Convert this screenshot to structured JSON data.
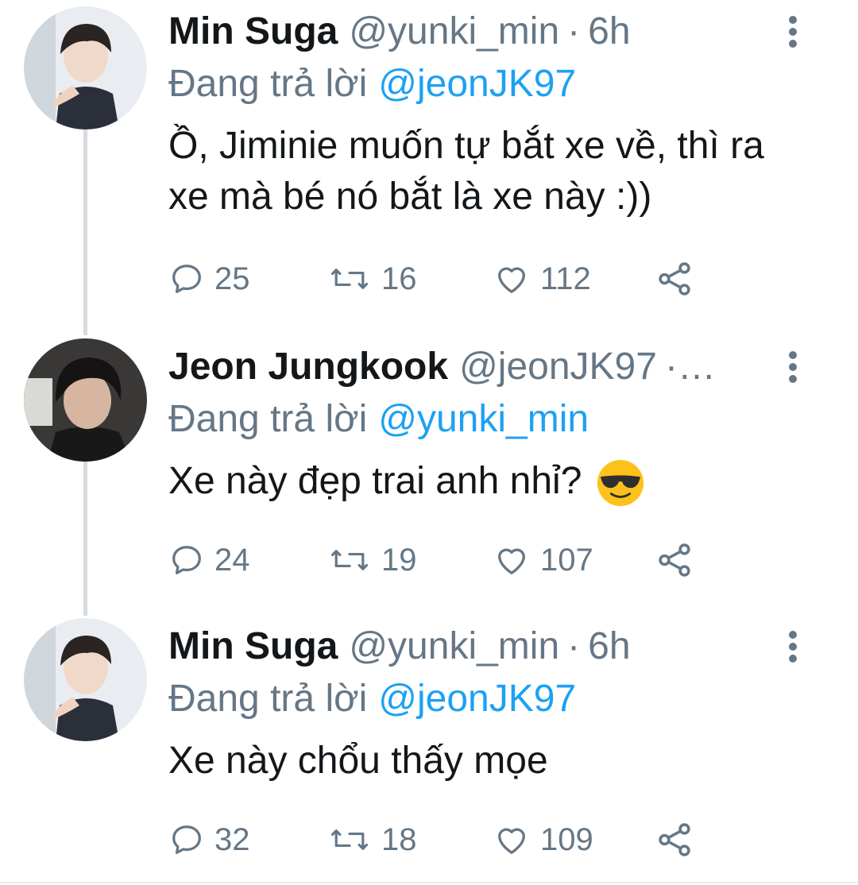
{
  "tweets": [
    {
      "author": "Min Suga",
      "handle": "@yunki_min",
      "separator": "·",
      "time": "6h",
      "reply_prefix": "Đang trả lời",
      "reply_to": "@jeonJK97",
      "text": "Ồ, Jiminie muốn tự bắt xe về, thì ra xe mà bé nó bắt là xe này :))",
      "replies": "25",
      "retweets": "16",
      "likes": "112"
    },
    {
      "author": "Jeon Jungkook",
      "handle": "@jeonJK97",
      "separator": "·…",
      "time": "",
      "reply_prefix": "Đang trả lời",
      "reply_to": "@yunki_min",
      "text": "Xe này đẹp trai anh nhỉ?",
      "emoji": "smiling-face-with-sunglasses",
      "replies": "24",
      "retweets": "19",
      "likes": "107"
    },
    {
      "author": "Min Suga",
      "handle": "@yunki_min",
      "separator": "·",
      "time": "6h",
      "reply_prefix": "Đang trả lời",
      "reply_to": "@jeonJK97",
      "text": "Xe này chổu thấy mọe",
      "replies": "32",
      "retweets": "18",
      "likes": "109"
    }
  ],
  "colors": {
    "name": "#14171a",
    "secondary": "#657786",
    "link": "#1da1f2",
    "thread_line": "#d6dbdf"
  }
}
